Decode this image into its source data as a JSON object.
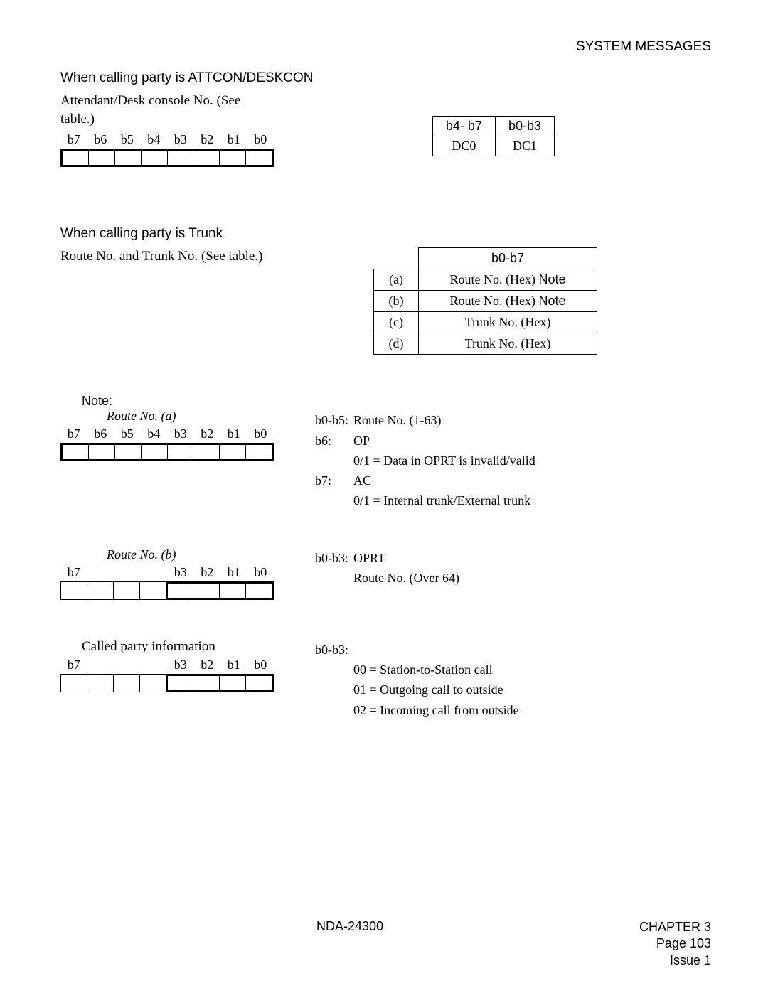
{
  "header": {
    "title": "SYSTEM MESSAGES"
  },
  "sec1": {
    "title": "When calling party is ATTCON/DESKCON",
    "desc_l1": "Attendant/Desk console No. (See",
    "desc_l2": "table.)"
  },
  "bits": {
    "b7": "b7",
    "b6": "b6",
    "b5": "b5",
    "b4": "b4",
    "b3": "b3",
    "b2": "b2",
    "b1": "b1",
    "b0": "b0"
  },
  "dc_table": {
    "h1": "b4- b7",
    "h2": "b0-b3",
    "c1": "DC0",
    "c2": "DC1"
  },
  "sec2": {
    "title": "When calling party is Trunk",
    "desc": "Route No. and Trunk No. (See table.)"
  },
  "trunk_table": {
    "header": "b0-b7",
    "rows": [
      {
        "k": "(a)",
        "v_pre": "Route No. (Hex) ",
        "v_note": "Note"
      },
      {
        "k": "(b)",
        "v_pre": "Route No. (Hex) ",
        "v_note": "Note"
      },
      {
        "k": "(c)",
        "v_pre": "Trunk No. (Hex)",
        "v_note": ""
      },
      {
        "k": "(d)",
        "v_pre": "Trunk No. (Hex)",
        "v_note": ""
      }
    ]
  },
  "note": {
    "label": "Note:",
    "routeA_title": "Route No. (a)",
    "routeB_title": "Route No. (b)",
    "called_title": "Called party information",
    "routeA_right": {
      "l1_k": "b0-b5:",
      "l1_v": "Route No. (1-63)",
      "l2_k": "b6:",
      "l2_v": "OP",
      "l3_v": "0/1 = Data in OPRT is invalid/valid",
      "l4_k": "b7:",
      "l4_v": "AC",
      "l5_v": "0/1 = Internal trunk/External trunk"
    },
    "routeB_right": {
      "l1_k": "b0-b3:",
      "l1_v": "OPRT",
      "l2_v": "Route No. (Over 64)"
    },
    "called_right": {
      "l1_k": "b0-b3:",
      "l2": "00 = Station-to-Station call",
      "l3": "01 = Outgoing call to outside",
      "l4": "02 = Incoming call from outside"
    }
  },
  "footer": {
    "doc": "NDA-24300",
    "chapter": "CHAPTER 3",
    "page": "Page 103",
    "issue": "Issue 1"
  }
}
